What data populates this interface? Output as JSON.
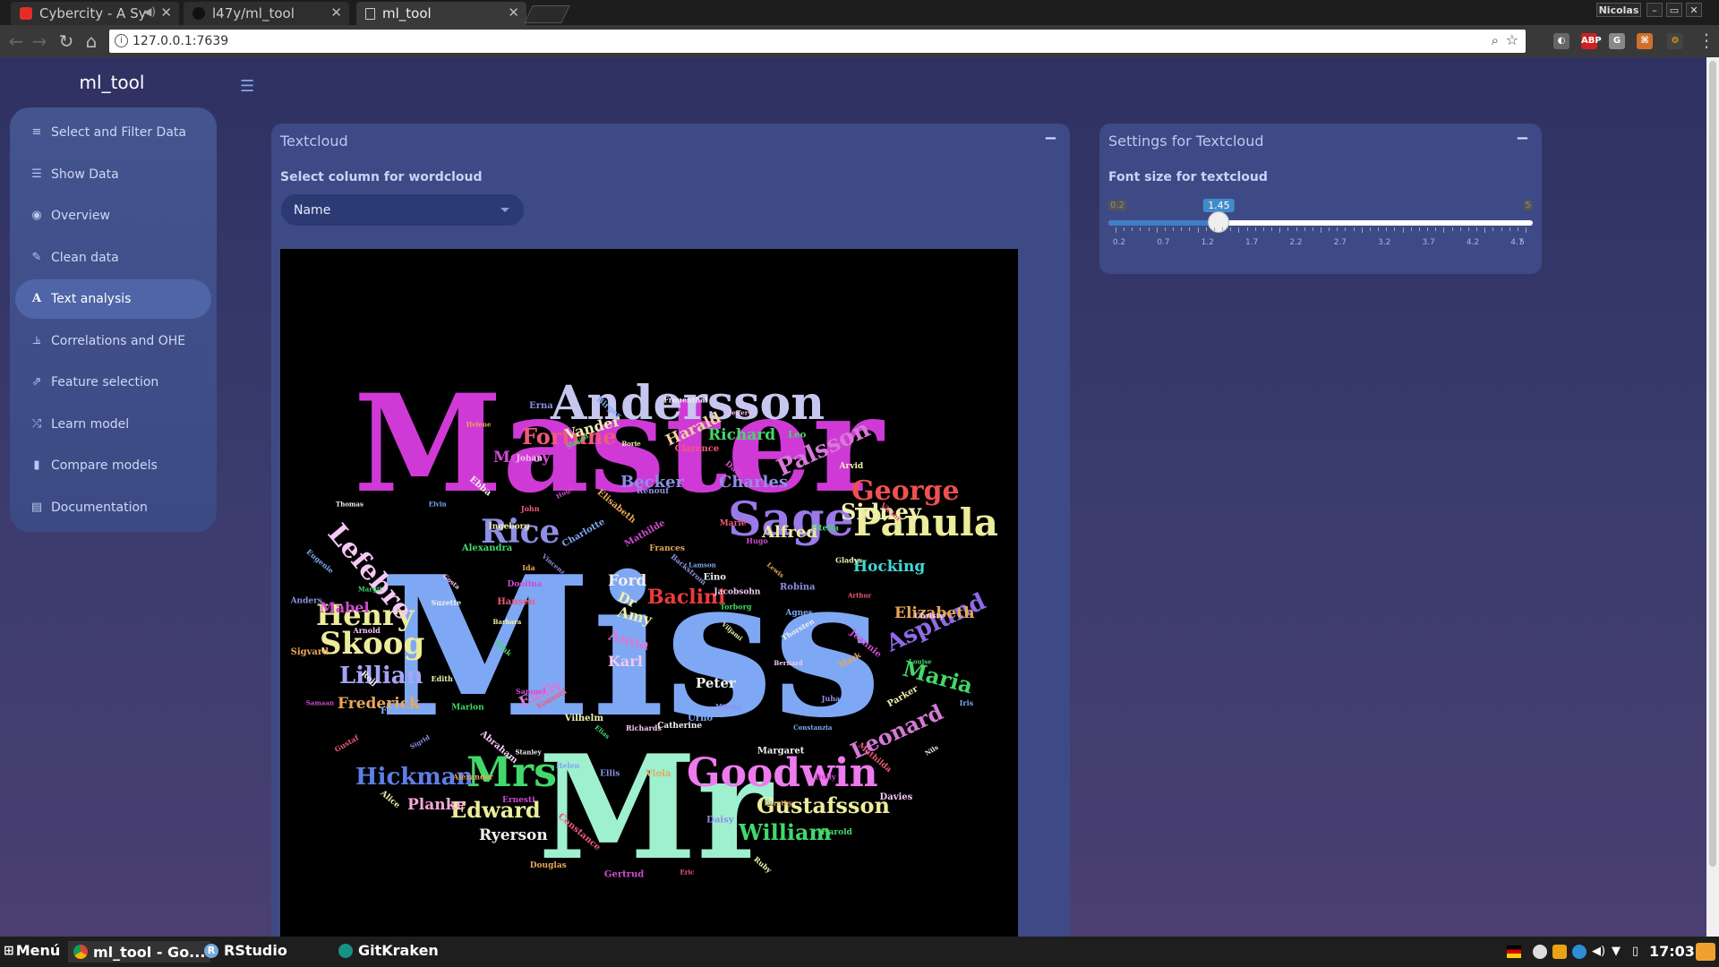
{
  "browser": {
    "tabs": [
      {
        "label": "Cybercity - A Sy",
        "icon": "youtube-icon",
        "color": "#e52d27"
      },
      {
        "label": "l47y/ml_tool",
        "icon": "github-icon",
        "color": "#222222"
      },
      {
        "label": "ml_tool",
        "icon": "page-icon",
        "color": "#dddddd"
      }
    ],
    "user": "Nicolas",
    "url": "127.0.0.1:7639",
    "window_controls": [
      "–",
      "▭",
      "✕"
    ]
  },
  "app": {
    "brand": "ml_tool",
    "sidebar": {
      "items": [
        {
          "label": "Select and Filter Data",
          "icon": "database-icon",
          "glyph": "≡"
        },
        {
          "label": "Show Data",
          "icon": "table-icon",
          "glyph": "☰"
        },
        {
          "label": "Overview",
          "icon": "eye-icon",
          "glyph": "◉"
        },
        {
          "label": "Clean data",
          "icon": "wrench-icon",
          "glyph": "✎"
        },
        {
          "label": "Text analysis",
          "icon": "font-icon",
          "glyph": "A"
        },
        {
          "label": "Correlations and OHE",
          "icon": "chart-icon",
          "glyph": "⫡"
        },
        {
          "label": "Feature selection",
          "icon": "share-icon",
          "glyph": "⇗"
        },
        {
          "label": "Learn model",
          "icon": "random-icon",
          "glyph": "⤮"
        },
        {
          "label": "Compare models",
          "icon": "bar-chart-icon",
          "glyph": "▮"
        },
        {
          "label": "Documentation",
          "icon": "file-icon",
          "glyph": "▤"
        }
      ],
      "active_index": 4
    },
    "textcloud_box": {
      "title": "Textcloud",
      "minimize": "−",
      "select_label": "Select column for wordcloud",
      "select_value": "Name"
    },
    "settings_box": {
      "title": "Settings for Textcloud",
      "minimize": "−",
      "slider_label": "Font size for textcloud",
      "slider_min": "0.2",
      "slider_max": "5",
      "slider_value": "1.45",
      "slider_value_num": 1.45,
      "tick_labels": [
        "0.2",
        "0.7",
        "1.2",
        "1.7",
        "2.2",
        "2.7",
        "3.2",
        "3.7",
        "4.2",
        "4.7",
        "5"
      ]
    }
  },
  "wordcloud": [
    "Master",
    "Miss",
    "Mr",
    "Mrs",
    "Andersson",
    "Sage",
    "Goodwin",
    "Panula",
    "George",
    "Fortune",
    "Rice",
    "Skoog",
    "Henry",
    "Lefebre",
    "Lillian",
    "Palsson",
    "Sidney",
    "Asplund",
    "Gustafsson",
    "Maria",
    "Leonard",
    "Hickman",
    "William",
    "Edward",
    "Baclini",
    "Becker",
    "Charles",
    "Richard",
    "Harald",
    "Vander",
    "McCoy",
    "Elizabeth",
    "Alfred",
    "Hocking",
    "Mabel",
    "Frederick",
    "Ryerson",
    "Planke",
    "Karl",
    "Amy",
    "Anna",
    "Emily",
    "Peter",
    "Ford",
    "Dr",
    "Viljami",
    "Samuel",
    "Renouf",
    "Margaret",
    "Margit",
    "Victor",
    "Douglas",
    "Charlotte",
    "Bernard",
    "Edith",
    "Dale",
    "Daisy",
    "Thomas",
    "Torborg",
    "Youssef",
    "Elisabeth",
    "Constanzia",
    "Arnold",
    "Arvid",
    "Gertrud",
    "Vincenz",
    "Thorsten",
    "Marion",
    "Clarence",
    "Dorothy",
    "Eugenie",
    "Jacobsohn",
    "Vilhelm",
    "Hugh",
    "Juha",
    "Rojj",
    "Leo",
    "Eric",
    "Ida",
    "Agnes",
    "Abraham",
    "Borie",
    "Dolly",
    "Anders",
    "Eino",
    "Elias",
    "John",
    "Mark",
    "Forbes",
    "Jeffery",
    "Ruby",
    "Doolina",
    "Robina",
    "Stanley",
    "Susan",
    "Mathilda",
    "Sigvard",
    "Lamson",
    "Richards",
    "Ingeborg",
    "Jeannie",
    "Sigrid",
    "Frauenthal",
    "Harold",
    "Hansen",
    "Lewis",
    "Helen",
    "Johan",
    "Parker",
    "Samaan",
    "Backstrom",
    "Catherine",
    "Alexandra",
    "Arthur",
    "Alexander",
    "Birger",
    "Davies",
    "Barbara",
    "Hugo",
    "Ellis",
    "Ebba",
    "Louise",
    "Gustaf",
    "Frances",
    "Urho",
    "Gosta",
    "Gladys",
    "Ernesti",
    "Erna",
    "Nils",
    "Kink",
    "Marie",
    "Viola",
    "Elvin",
    "Christy",
    "Alice",
    "Mathilde",
    "Mischa",
    "Suzette",
    "Stella",
    "Constance",
    "Helene",
    "Iris"
  ]
}
